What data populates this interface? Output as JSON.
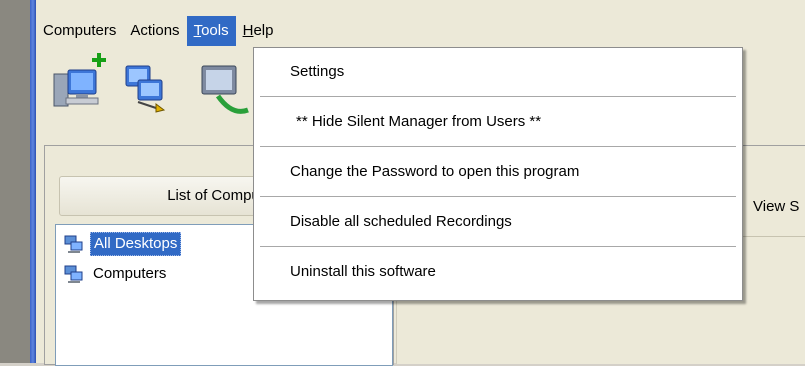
{
  "menubar": {
    "items": [
      {
        "label": "Computers",
        "active": false
      },
      {
        "label": "Actions",
        "active": false
      },
      {
        "label_ul": "T",
        "label_rest": "ools",
        "active": true
      },
      {
        "label_ul": "H",
        "label_rest": "elp",
        "active": false
      }
    ]
  },
  "toolbar": {
    "icons": [
      "add-computer-icon",
      "network-computers-icon",
      "remote-computer-icon"
    ]
  },
  "left_panel": {
    "header": "List of Computers",
    "tree": [
      {
        "label": "All Desktops",
        "icon": "computers-group-icon",
        "selected": true
      },
      {
        "label": "Computers",
        "icon": "computers-group-icon",
        "selected": false
      }
    ]
  },
  "right_panel": {
    "tab_label": "View S"
  },
  "tools_menu": {
    "items": [
      "Settings",
      " ** Hide Silent Manager from Users **",
      "Change the Password to open this program",
      "Disable all scheduled Recordings",
      "Uninstall this software"
    ]
  },
  "colors": {
    "selection": "#316ac5",
    "window_face": "#ece9d8",
    "xp_blue_border": "#3a62c8"
  }
}
